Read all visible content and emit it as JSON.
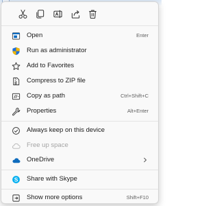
{
  "toolbar": {
    "icons": [
      "cut-icon",
      "copy-icon",
      "rename-icon",
      "share-icon",
      "delete-icon"
    ]
  },
  "menu": {
    "open": {
      "label": "Open",
      "shortcut": "Enter"
    },
    "run_admin": {
      "label": "Run as administrator"
    },
    "add_favorites": {
      "label": "Add to Favorites"
    },
    "compress_zip": {
      "label": "Compress to ZIP file"
    },
    "copy_path": {
      "label": "Copy as path",
      "shortcut": "Ctrl+Shift+C"
    },
    "properties": {
      "label": "Properties",
      "shortcut": "Alt+Enter"
    },
    "keep_on_device": {
      "label": "Always keep on this device"
    },
    "free_up_space": {
      "label": "Free up space"
    },
    "onedrive": {
      "label": "OneDrive"
    },
    "share_skype": {
      "label": "Share with Skype"
    },
    "more_options": {
      "label": "Show more options",
      "shortcut": "Shift+F10"
    }
  },
  "colors": {
    "accent": "#0067c0",
    "skype": "#00aff0",
    "text": "#1a1a1a",
    "disabled": "#a4a4a4"
  }
}
